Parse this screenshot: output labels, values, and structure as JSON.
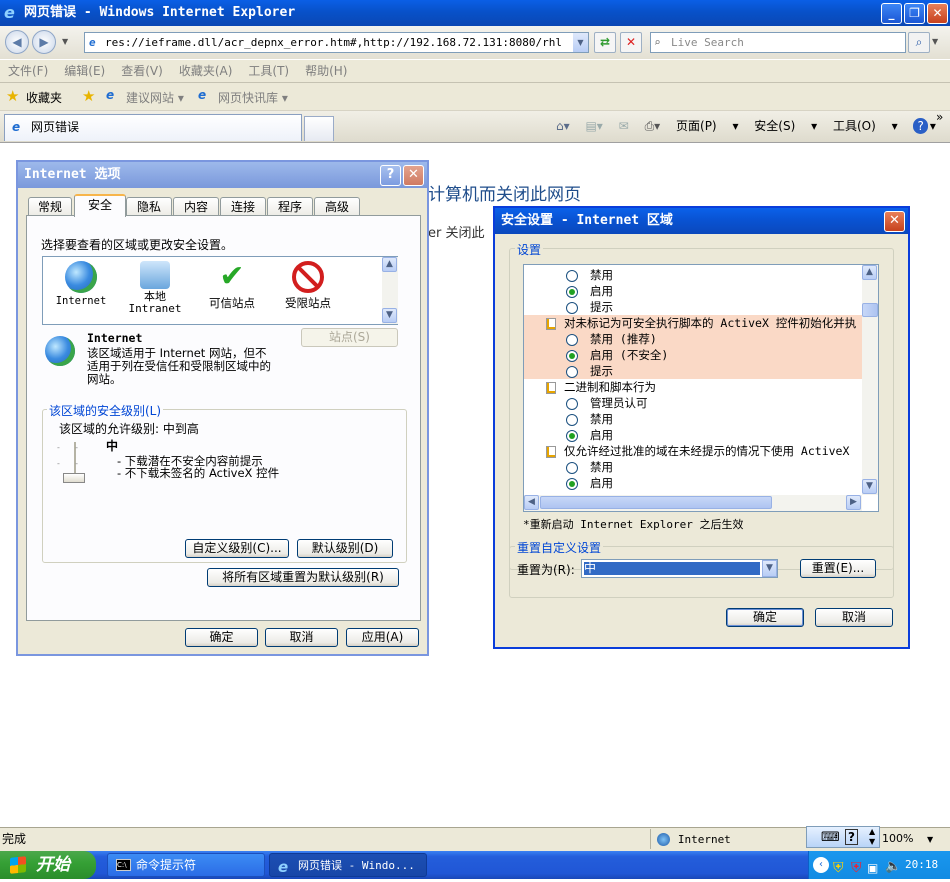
{
  "window": {
    "title": "网页错误 - Windows Internet Explorer"
  },
  "address_bar": {
    "url": "res://ieframe.dll/acr_depnx_error.htm#,http://192.168.72.131:8080/rhl",
    "search_placeholder": "Live Search"
  },
  "menu": [
    "文件(F)",
    "编辑(E)",
    "查看(V)",
    "收藏夹(A)",
    "工具(T)",
    "帮助(H)"
  ],
  "favorites_bar": {
    "favorites": "收藏夹",
    "suggested_sites": "建议网站",
    "web_slice": "网页快讯库"
  },
  "tab": {
    "label": "网页错误"
  },
  "command_bar": {
    "page": "页面(P)",
    "safety": "安全(S)",
    "tools": "工具(O)"
  },
  "page_content": {
    "heading_fragment": "计算机而关闭此网页",
    "line_fragment": "er 关闭此"
  },
  "internet_options": {
    "title": "Internet 选项",
    "tabs": [
      "常规",
      "安全",
      "隐私",
      "内容",
      "连接",
      "程序",
      "高级"
    ],
    "active_tab": "安全",
    "zone_prompt": "选择要查看的区域或更改安全设置。",
    "zones": [
      {
        "name": "Internet",
        "icon": "globe-icon"
      },
      {
        "name": "本地\nIntranet",
        "icon": "intranet-icon"
      },
      {
        "name": "可信站点",
        "icon": "checkmark-icon"
      },
      {
        "name": "受限站点",
        "icon": "restricted-icon"
      }
    ],
    "selected_zone_title": "Internet",
    "selected_zone_desc": "该区域适用于 Internet 网站，但不适用于列在受信任和受限制区域中的网站。",
    "sites_button": "站点(S)",
    "security_level_legend": "该区域的安全级别(L)",
    "allowed_levels": "该区域的允许级别: 中到高",
    "level_name": "中",
    "level_bullets": [
      "- 下载潜在不安全内容前提示",
      "- 不下载未签名的 ActiveX 控件"
    ],
    "custom_level_button": "自定义级别(C)...",
    "default_level_button": "默认级别(D)",
    "reset_all_button": "将所有区域重置为默认级别(R)",
    "ok": "确定",
    "cancel": "取消",
    "apply": "应用(A)"
  },
  "security_settings": {
    "title": "安全设置 - Internet 区域",
    "settings_label": "设置",
    "items": [
      {
        "type": "radio",
        "label": "禁用",
        "checked": false
      },
      {
        "type": "radio",
        "label": "启用",
        "checked": true
      },
      {
        "type": "radio",
        "label": "提示",
        "checked": false
      },
      {
        "type": "header",
        "label": "对未标记为可安全执行脚本的 ActiveX 控件初始化并执",
        "highlight": true
      },
      {
        "type": "radio",
        "label": "禁用 (推荐)",
        "checked": false,
        "highlight": true
      },
      {
        "type": "radio",
        "label": "启用 (不安全)",
        "checked": true,
        "highlight": true
      },
      {
        "type": "radio",
        "label": "提示",
        "checked": false,
        "highlight": true
      },
      {
        "type": "header",
        "label": "二进制和脚本行为"
      },
      {
        "type": "radio",
        "label": "管理员认可",
        "checked": false
      },
      {
        "type": "radio",
        "label": "禁用",
        "checked": false
      },
      {
        "type": "radio",
        "label": "启用",
        "checked": true
      },
      {
        "type": "header",
        "label": "仅允许经过批准的域在未经提示的情况下使用 ActiveX"
      },
      {
        "type": "radio",
        "label": "禁用",
        "checked": false
      },
      {
        "type": "radio",
        "label": "启用",
        "checked": true
      }
    ],
    "restart_note": "*重新启动 Internet Explorer 之后生效",
    "reset_legend": "重置自定义设置",
    "reset_to_label": "重置为(R):",
    "reset_to_value": "中",
    "reset_button": "重置(E)...",
    "ok": "确定",
    "cancel": "取消"
  },
  "status_bar": {
    "text": "完成",
    "zone": "Internet",
    "zoom": "100%"
  },
  "taskbar": {
    "start": "开始",
    "tasks": [
      "命令提示符",
      "网页错误 - Windo..."
    ],
    "time": "20:18"
  }
}
